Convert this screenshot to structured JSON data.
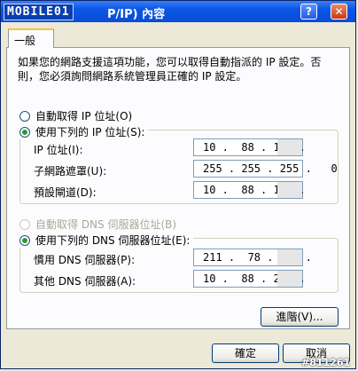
{
  "window": {
    "logo_text": "MOBILE01",
    "title": "P/IP) 內容",
    "help_label": "?",
    "close_label": "✕"
  },
  "tabs": [
    {
      "label": "一般"
    }
  ],
  "description": "如果您的網路支援這項功能，您可以取得自動指派的 IP 設定。否則，您必須詢問網路系統管理員正確的 IP 設定。",
  "ip": {
    "auto_label": "自動取得 IP 位址(O)",
    "manual_label": "使用下列的 IP 位址(S):",
    "selected": "manual",
    "fields": [
      {
        "label": "IP 位址(I):",
        "value": "10 .  88 . 195 ."
      },
      {
        "label": "子網路遮罩(U):",
        "value": "255 . 255 . 255 .   0"
      },
      {
        "label": "預設閘道(D):",
        "value": "10 .  88 . 195 ."
      }
    ]
  },
  "dns": {
    "auto_label": "自動取得 DNS 伺服器位址(B)",
    "manual_label": "使用下列的 DNS 伺服器位址(E):",
    "selected": "manual",
    "fields": [
      {
        "label": "慣用 DNS 伺服器(P):",
        "value": "211 .  78 . 130 ."
      },
      {
        "label": "其他 DNS 伺服器(A):",
        "value": "10 .  88 . 251 ."
      }
    ]
  },
  "buttons": {
    "advanced": "進階(V)...",
    "ok": "確定",
    "cancel": "取消"
  },
  "watermark": "#811261"
}
